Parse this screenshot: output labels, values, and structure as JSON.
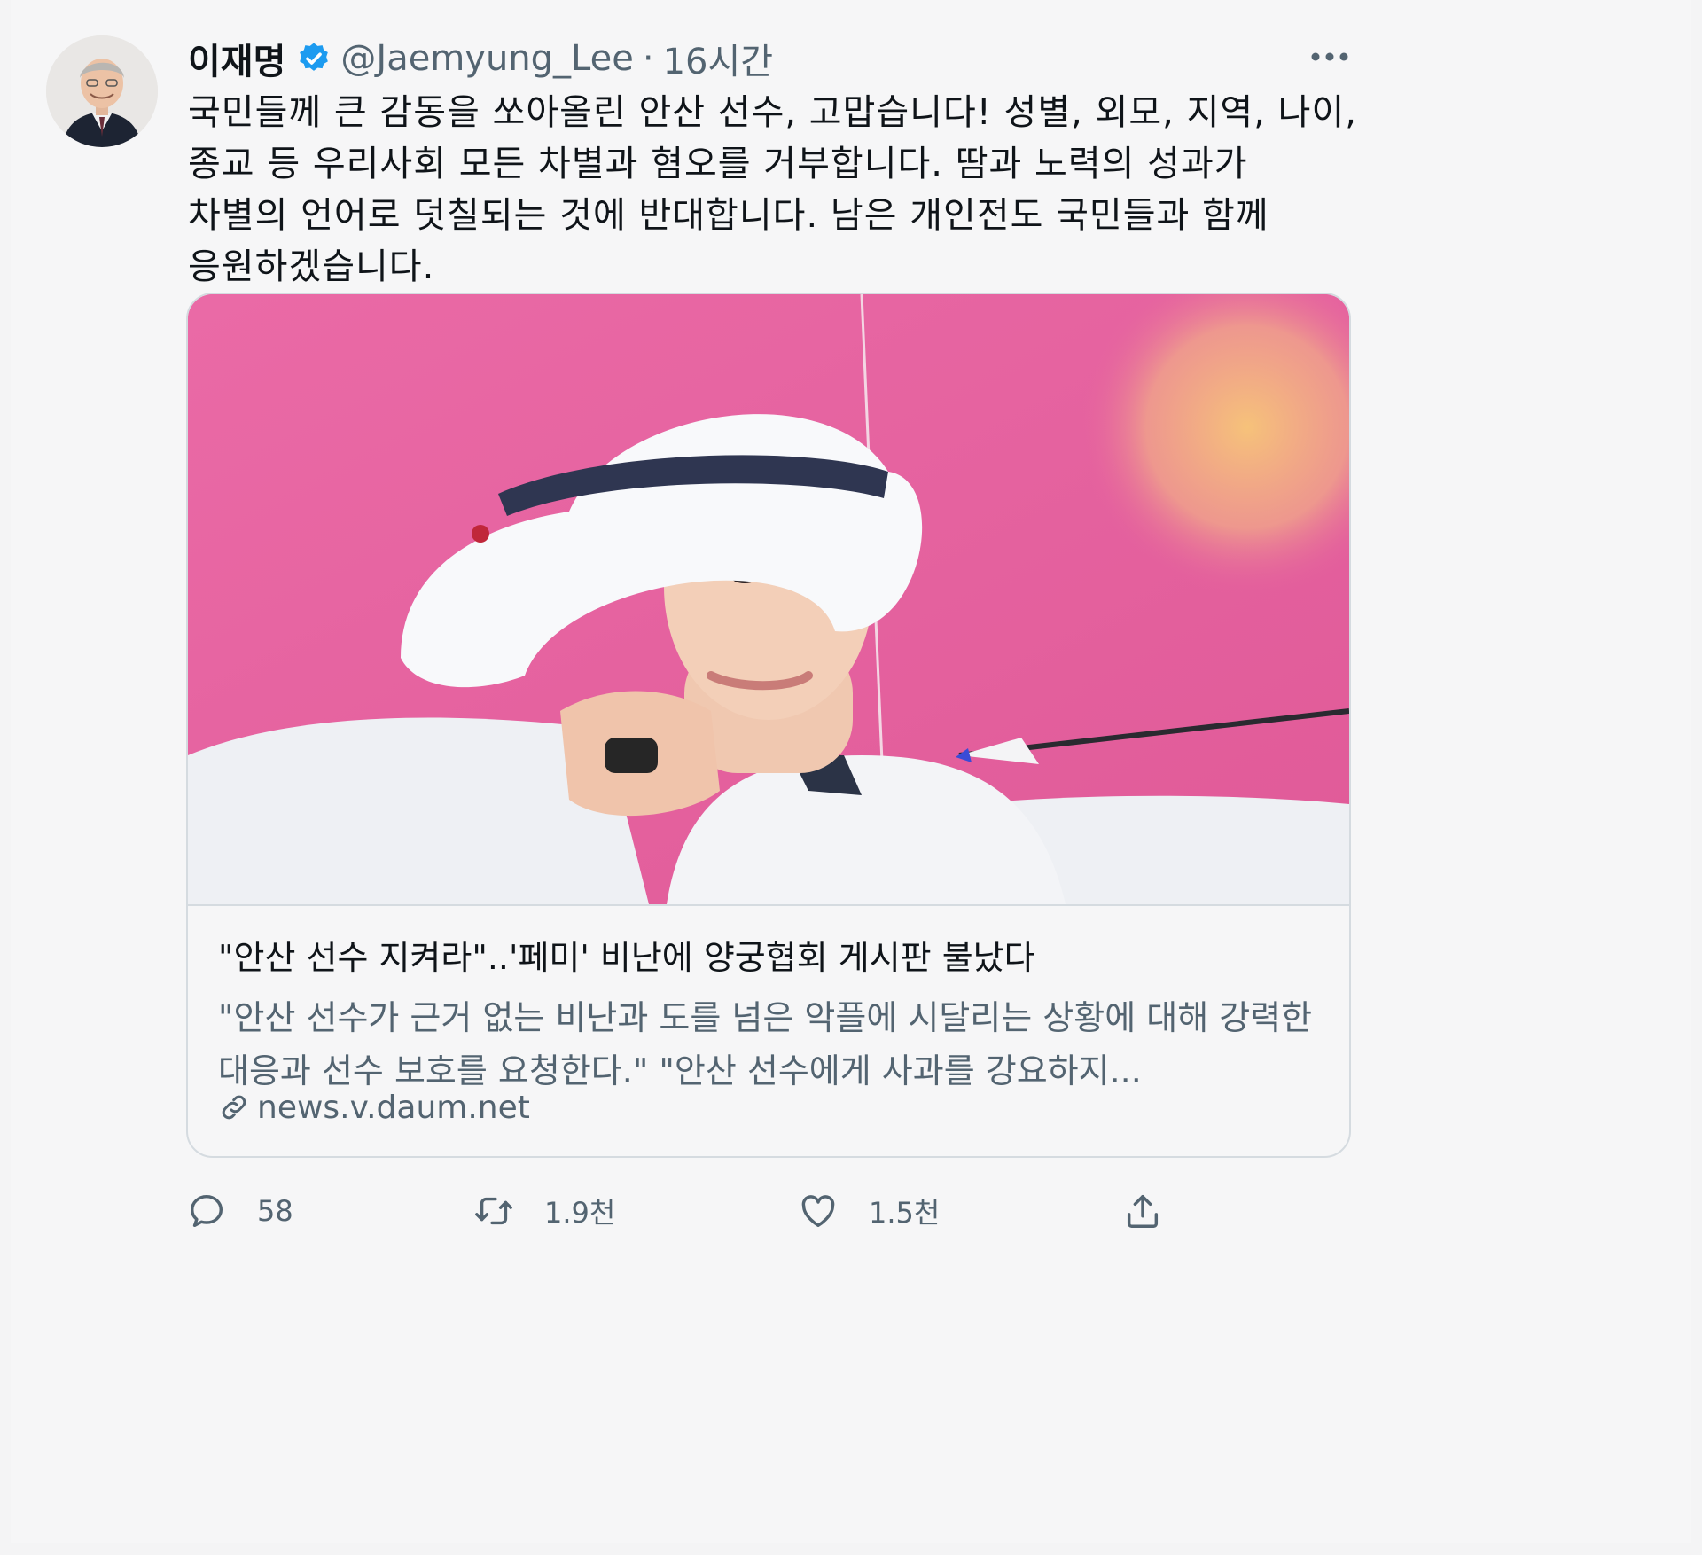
{
  "tweet": {
    "author": {
      "display_name": "이재명",
      "verified_icon": "verified-badge-icon",
      "handle": "@Jaemyung_Lee",
      "separator": "·",
      "time": "16시간"
    },
    "text": "국민들께 큰 감동을 쏘아올린 안산 선수, 고맙습니다! 성별, 외모, 지역, 나이, 종교 등 우리사회 모든 차별과 혐오를 거부합니다. 땀과 노력의 성과가 차별의 언어로 덧칠되는 것에 반대합니다. 남은 개인전도 국민들과 함께 응원하겠습니다.",
    "card": {
      "title": "\"안산 선수 지켜라\"..'페미' 비난에 양궁협회 게시판 불났다",
      "description": "\"안산 선수가 근거 없는 비난과 도를 넘은 악플에 시달리는 상황에 대해 강력한 대응과 선수 보호를 요청한다.\" \"안산 선수에게 사과를 강요하지...",
      "domain": "news.v.daum.net"
    },
    "actions": {
      "reply_count": "58",
      "retweet_count": "1.9천",
      "like_count": "1.5천"
    }
  },
  "colors": {
    "text_primary": "#0f1419",
    "text_secondary": "#536471",
    "verified_blue": "#1d9bf0",
    "card_border": "#d5dbe0",
    "photo_background_pink": "#e6629f"
  }
}
